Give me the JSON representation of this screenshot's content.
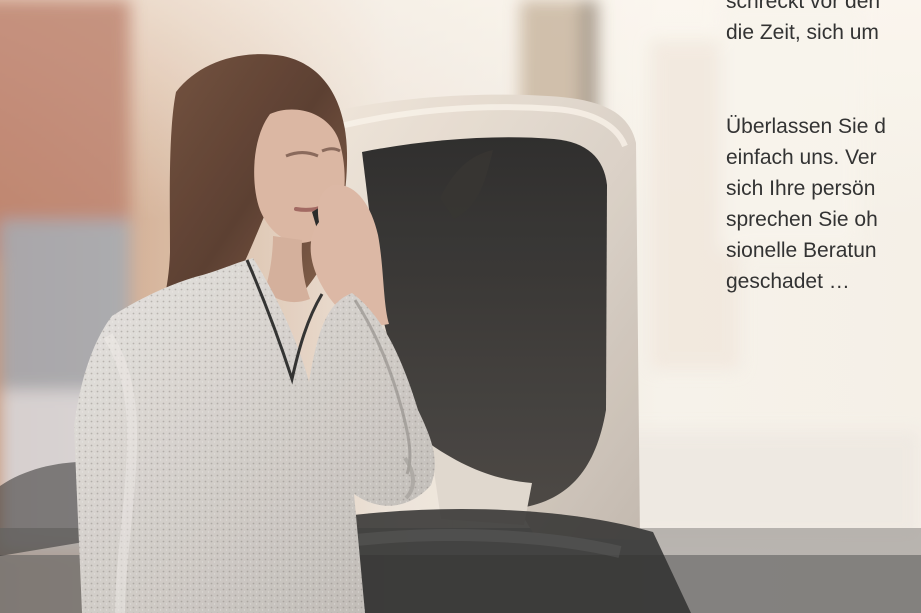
{
  "article": {
    "paragraph_1": [
      "schreckt vor den",
      "die Zeit, sich um"
    ],
    "paragraph_2": [
      "Überlassen Sie d",
      "einfach uns. Ver",
      "sich Ihre persön",
      "sprechen Sie oh",
      "sionelle Beratun",
      "geschadet …"
    ]
  },
  "image": {
    "subject": "woman-on-phone-near-broken-car",
    "colors": {
      "background": "#f6f1ea",
      "text": "#333333",
      "blouse": "#d8d5d1",
      "hair": "#5a3928",
      "car": "#e6ddd2"
    }
  }
}
